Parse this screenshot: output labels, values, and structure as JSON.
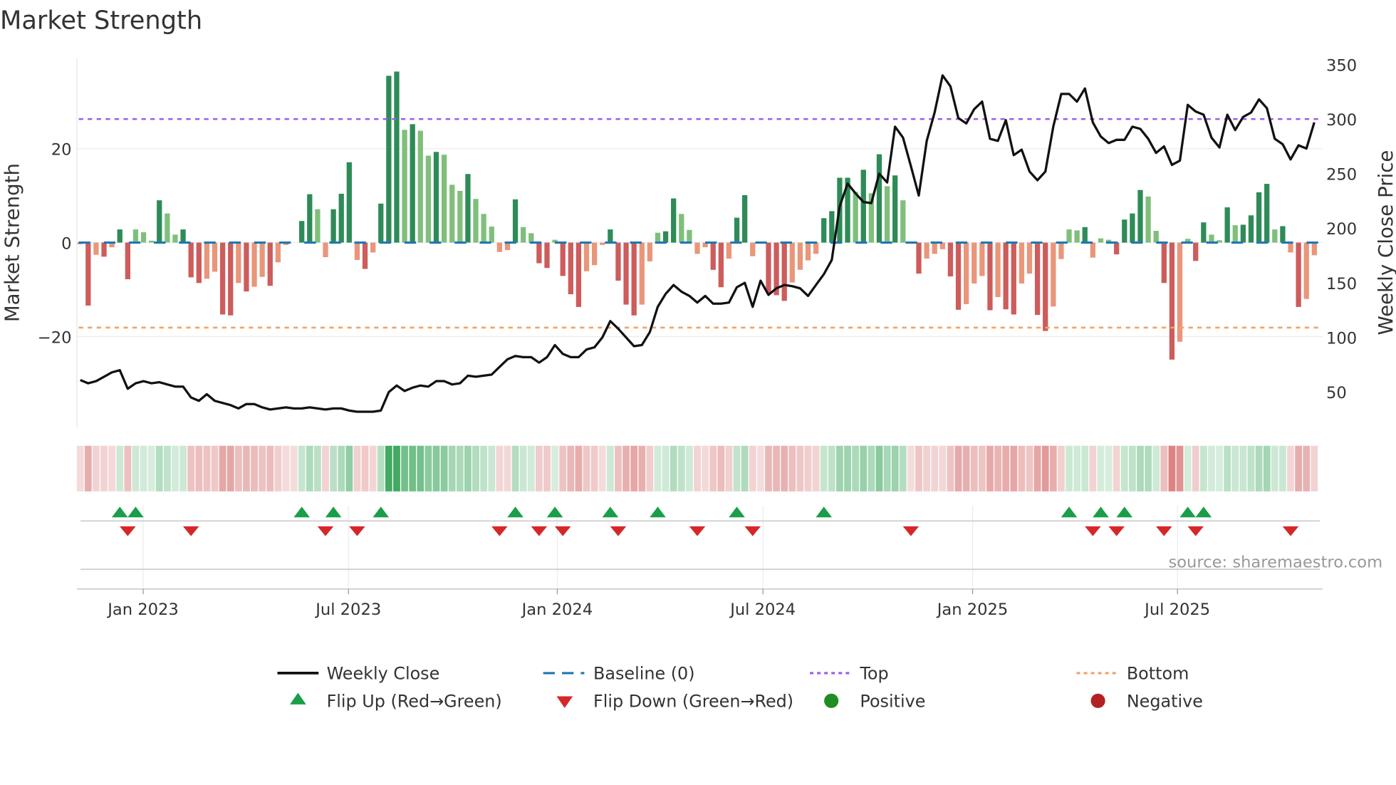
{
  "title": "Market Strength",
  "source": "source: sharemaestro.com",
  "colors": {
    "pos_dark": "#2e8b57",
    "pos_light": "#7fbf7b",
    "neg_dark": "#cd5c5c",
    "neg_light": "#e9967a",
    "baseline": "#1f77b4",
    "top": "#9b5de5",
    "bottom": "#f4a261",
    "flip_up": "#1a9e49",
    "flip_down": "#d62728",
    "positive": "#228b22",
    "negative": "#b22222",
    "price": "#111111"
  },
  "legend": {
    "weekly_close": "Weekly Close",
    "baseline": "Baseline (0)",
    "top": "Top",
    "bottom": "Bottom",
    "flip_up": "Flip Up (Red→Green)",
    "flip_down": "Flip Down (Green→Red)",
    "positive": "Positive",
    "negative": "Negative"
  },
  "chart_data": {
    "type": "bar",
    "title": "Market Strength",
    "ylabel": "Market Strength",
    "y2label": "Weekly Close Price",
    "ylim": [
      -39.4,
      39.2
    ],
    "y2lim": [
      17,
      356
    ],
    "yticks": [
      "20",
      "0",
      "−20"
    ],
    "yticks_values": [
      20,
      0,
      -20
    ],
    "y2ticks": [
      "350",
      "300",
      "250",
      "200",
      "150",
      "100",
      "50"
    ],
    "y2ticks_values": [
      350,
      300,
      250,
      200,
      150,
      100,
      50
    ],
    "xticks": [
      {
        "label": "Jan 2023",
        "week": 8.95
      },
      {
        "label": "Jul 2023",
        "week": 34.9
      },
      {
        "label": "Jan 2024",
        "week": 61.3
      },
      {
        "label": "Jul 2024",
        "week": 87.3
      },
      {
        "label": "Jan 2025",
        "week": 113.8
      },
      {
        "label": "Jul 2025",
        "week": 139.7
      }
    ],
    "top_threshold": 26.3,
    "bottom_threshold": -18.1,
    "grid": true,
    "legend_position": "bottom",
    "series": [
      {
        "name": "Market Strength",
        "type": "bar",
        "values": [
          -0.3,
          -13.4,
          -2.6,
          -3.0,
          -1.0,
          2.8,
          -7.8,
          2.8,
          2.2,
          0.4,
          9.0,
          6.2,
          1.7,
          2.8,
          -7.4,
          -8.6,
          -7.7,
          -6.2,
          -15.3,
          -15.5,
          -8.6,
          -10.4,
          -9.4,
          -7.3,
          -9.2,
          -4.2,
          -0.5,
          0,
          4.6,
          10.3,
          7.1,
          -3.1,
          7.1,
          10.4,
          17.1,
          -3.7,
          -5.6,
          -2.1,
          8.3,
          35.5,
          36.4,
          24.0,
          25.2,
          23.8,
          18.5,
          19.3,
          18.7,
          12.3,
          11.0,
          14.6,
          9.3,
          6.1,
          3.4,
          -2.0,
          -1.6,
          9.2,
          3.3,
          2.0,
          -4.4,
          -5.4,
          0.6,
          -7.1,
          -11.0,
          -13.7,
          -6.1,
          -4.8,
          -0.5,
          2.8,
          -8.1,
          -13.2,
          -15.5,
          -13.2,
          -4.0,
          2.1,
          2.4,
          9.4,
          6.1,
          2.7,
          -2.4,
          -1.0,
          -5.8,
          -9.5,
          -3.4,
          5.3,
          10.1,
          -2.9,
          0,
          -10.7,
          -11.2,
          -12.4,
          -8.5,
          -5.8,
          -3.8,
          -2.4,
          5.2,
          6.7,
          13.8,
          13.8,
          10.8,
          15.5,
          10.5,
          18.8,
          12.0,
          14.3,
          9.0,
          0,
          -6.6,
          -3.4,
          -2.4,
          -1.4,
          -7.2,
          -14.3,
          -13.1,
          -8.7,
          -7.1,
          -14.4,
          -11.6,
          -14.2,
          -15.3,
          -8.7,
          -6.6,
          -15.4,
          -18.8,
          -13.6,
          -3.5,
          2.8,
          2.6,
          3.3,
          -3.2,
          0.9,
          0.6,
          -2.5,
          4.9,
          6.2,
          11.2,
          9.8,
          2.5,
          -8.6,
          -24.9,
          -21.1,
          0.8,
          -3.9,
          4.3,
          1.7,
          0.5,
          7.5,
          3.7,
          3.8,
          5.8,
          10.7,
          12.5,
          2.8,
          3.5,
          -2.1,
          -13.7,
          -12.0,
          -2.7
        ]
      },
      {
        "name": "Weekly Close",
        "type": "line",
        "axis": "right",
        "values": [
          61,
          58,
          60,
          64,
          68,
          70,
          53,
          58,
          60,
          58,
          59,
          57,
          55,
          55,
          45,
          42,
          48,
          42,
          40,
          38,
          35,
          39,
          39,
          36,
          34,
          35,
          36,
          35,
          35,
          36,
          35,
          34,
          35,
          35,
          33,
          32,
          32,
          32,
          33,
          50,
          56,
          51,
          54,
          56,
          55,
          60,
          60,
          57,
          58,
          65,
          64,
          65,
          66,
          73,
          80,
          83,
          82,
          82,
          77,
          82,
          93,
          85,
          82,
          82,
          89,
          91,
          100,
          115,
          108,
          100,
          92,
          93,
          105,
          128,
          140,
          148,
          142,
          138,
          132,
          138,
          131,
          131,
          132,
          146,
          150,
          128,
          152,
          139,
          145,
          148,
          147,
          145,
          138,
          148,
          158,
          171,
          220,
          241,
          232,
          224,
          223,
          250,
          242,
          293,
          283,
          257,
          230,
          280,
          306,
          340,
          330,
          301,
          296,
          309,
          316,
          282,
          280,
          299,
          267,
          272,
          252,
          244,
          252,
          293,
          323,
          323,
          316,
          328,
          297,
          284,
          278,
          281,
          281,
          293,
          291,
          282,
          269,
          275,
          258,
          262,
          313,
          307,
          304,
          283,
          274,
          304,
          290,
          302,
          306,
          318,
          310,
          282,
          277,
          263,
          276,
          273,
          297
        ]
      }
    ]
  }
}
